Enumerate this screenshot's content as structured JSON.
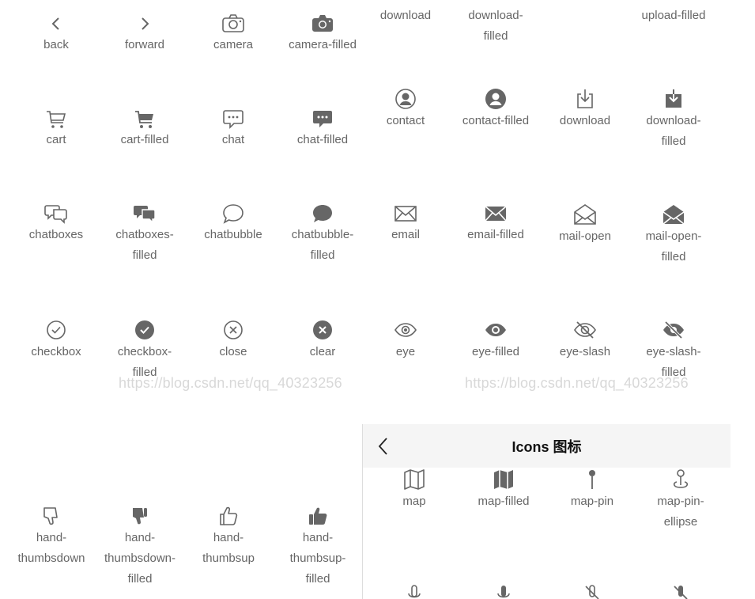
{
  "colors": {
    "icon": "#666666",
    "label": "#666666",
    "title": "#111111",
    "navbar_bg": "#f5f5f5",
    "watermark": "#d8d8d8"
  },
  "left_grid": [
    {
      "icon": "back-icon",
      "label": "back"
    },
    {
      "icon": "forward-icon",
      "label": "forward"
    },
    {
      "icon": "camera-icon",
      "label": "camera"
    },
    {
      "icon": "camera-filled-icon",
      "label": "camera-filled"
    },
    {
      "icon": "cart-icon",
      "label": "cart"
    },
    {
      "icon": "cart-filled-icon",
      "label": "cart-filled"
    },
    {
      "icon": "chat-icon",
      "label": "chat"
    },
    {
      "icon": "chat-filled-icon",
      "label": "chat-filled"
    },
    {
      "icon": "chatboxes-icon",
      "label": "chatboxes"
    },
    {
      "icon": "chatboxes-filled-icon",
      "label": "chatboxes-\nfilled"
    },
    {
      "icon": "chatbubble-icon",
      "label": "chatbubble"
    },
    {
      "icon": "chatbubble-filled-icon",
      "label": "chatbubble-\nfilled"
    },
    {
      "icon": "checkbox-icon",
      "label": "checkbox"
    },
    {
      "icon": "checkbox-filled-icon",
      "label": "checkbox-\nfilled"
    },
    {
      "icon": "close-icon",
      "label": "close"
    },
    {
      "icon": "clear-icon",
      "label": "clear"
    },
    {
      "icon": "hand-thumbsdown-icon",
      "label": "hand-\nthumbsdown"
    },
    {
      "icon": "hand-thumbsdown-filled-icon",
      "label": "hand-\nthumbsdown-\nfilled"
    },
    {
      "icon": "hand-thumbsup-icon",
      "label": "hand-\nthumbsup"
    },
    {
      "icon": "hand-thumbsup-filled-icon",
      "label": "hand-\nthumbsup-\nfilled"
    }
  ],
  "right_grid": [
    {
      "icon": "",
      "label": "download"
    },
    {
      "icon": "",
      "label": "download-\nfilled"
    },
    {
      "icon": "",
      "label": ""
    },
    {
      "icon": "",
      "label": "upload-filled"
    },
    {
      "icon": "contact-icon",
      "label": "contact"
    },
    {
      "icon": "contact-filled-icon",
      "label": "contact-filled"
    },
    {
      "icon": "download-icon",
      "label": "download"
    },
    {
      "icon": "download-filled-icon",
      "label": "download-\nfilled"
    },
    {
      "icon": "email-icon",
      "label": "email"
    },
    {
      "icon": "email-filled-icon",
      "label": "email-filled"
    },
    {
      "icon": "mail-open-icon",
      "label": "mail-open"
    },
    {
      "icon": "mail-open-filled-icon",
      "label": "mail-open-\nfilled"
    },
    {
      "icon": "eye-icon",
      "label": "eye"
    },
    {
      "icon": "eye-filled-icon",
      "label": "eye-filled"
    },
    {
      "icon": "eye-slash-icon",
      "label": "eye-slash"
    },
    {
      "icon": "eye-slash-filled-icon",
      "label": "eye-slash-\nfilled"
    }
  ],
  "navbar": {
    "back_icon": "chevron-left-icon",
    "title": "Icons 图标"
  },
  "lower_grid": [
    {
      "icon": "map-icon",
      "label": "map"
    },
    {
      "icon": "map-filled-icon",
      "label": "map-filled"
    },
    {
      "icon": "map-pin-icon",
      "label": "map-pin"
    },
    {
      "icon": "map-pin-ellipse-icon",
      "label": "map-pin-\nellipse"
    },
    {
      "icon": "mic-icon",
      "label": ""
    },
    {
      "icon": "mic-filled-icon",
      "label": ""
    },
    {
      "icon": "mic-slash-icon",
      "label": ""
    },
    {
      "icon": "mic-slash-filled-icon",
      "label": ""
    }
  ],
  "watermarks": [
    "https://blog.csdn.net/qq_40323256",
    "https://blog.csdn.net/qq_40323256"
  ]
}
